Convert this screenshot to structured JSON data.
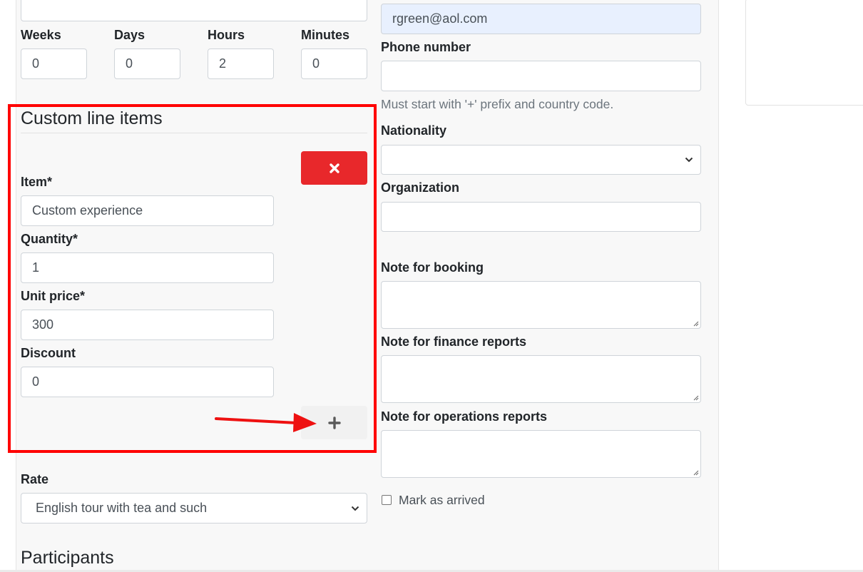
{
  "duration": {
    "weeks": {
      "label": "Weeks",
      "value": "0"
    },
    "days": {
      "label": "Days",
      "value": "0"
    },
    "hours": {
      "label": "Hours",
      "value": "2"
    },
    "minutes": {
      "label": "Minutes",
      "value": "0"
    }
  },
  "custom_line_items": {
    "title": "Custom line items",
    "item": {
      "label": "Item*",
      "value": "Custom experience"
    },
    "quantity": {
      "label": "Quantity*",
      "value": "1"
    },
    "unit_price": {
      "label": "Unit price*",
      "value": "300"
    },
    "discount": {
      "label": "Discount",
      "value": "0"
    },
    "delete_icon": "x-icon",
    "add_icon": "plus-icon"
  },
  "rate": {
    "label": "Rate",
    "selected": "English tour with tea and such"
  },
  "participants": {
    "title": "Participants"
  },
  "contact": {
    "email_value": "rgreen@aol.com",
    "phone": {
      "label": "Phone number",
      "value": "",
      "help": "Must start with '+' prefix and country code."
    },
    "nationality": {
      "label": "Nationality",
      "selected": ""
    },
    "organization": {
      "label": "Organization",
      "value": ""
    }
  },
  "notes": {
    "booking": {
      "label": "Note for booking",
      "value": ""
    },
    "finance": {
      "label": "Note for finance reports",
      "value": ""
    },
    "operations": {
      "label": "Note for operations reports",
      "value": ""
    }
  },
  "arrived": {
    "label": "Mark as arrived",
    "checked": false
  },
  "colors": {
    "highlight": "#ff0000",
    "delete_button": "#e8282b",
    "arrow": "#ee1111"
  }
}
